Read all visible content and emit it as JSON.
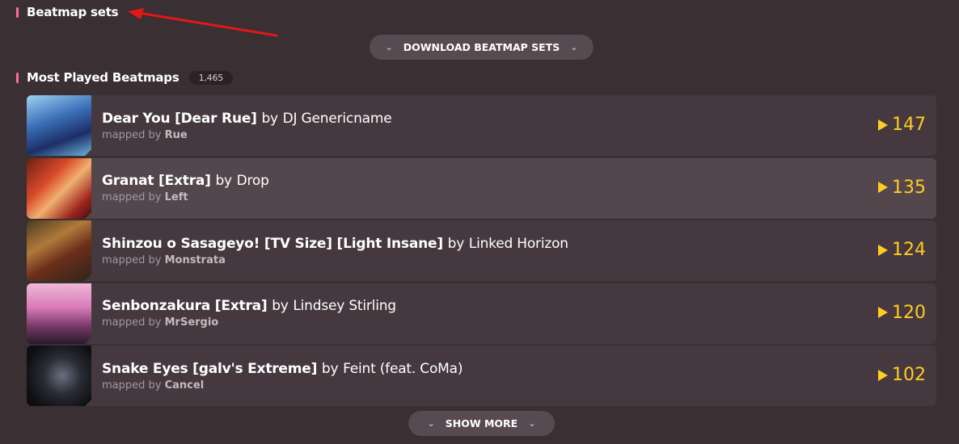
{
  "sections": {
    "beatmap_sets": {
      "title": "Beatmap sets"
    },
    "most_played": {
      "title": "Most Played Beatmaps",
      "count": "1,465"
    }
  },
  "buttons": {
    "download": "DOWNLOAD BEATMAP SETS",
    "show_more": "SHOW MORE"
  },
  "beatmaps": [
    {
      "title": "Dear You [Dear Rue]",
      "by": "by",
      "artist": "DJ Genericname",
      "mapped_by": "mapped by",
      "mapper": "Rue",
      "plays": "147"
    },
    {
      "title": "Granat [Extra]",
      "by": "by",
      "artist": "Drop",
      "mapped_by": "mapped by",
      "mapper": "Left",
      "plays": "135"
    },
    {
      "title": "Shinzou o Sasageyo! [TV Size] [Light Insane]",
      "by": "by",
      "artist": "Linked Horizon",
      "mapped_by": "mapped by",
      "mapper": "Monstrata",
      "plays": "124"
    },
    {
      "title": "Senbonzakura [Extra]",
      "by": "by",
      "artist": "Lindsey Stirling",
      "mapped_by": "mapped by",
      "mapper": "MrSergio",
      "plays": "120"
    },
    {
      "title": "Snake Eyes [galv's Extreme]",
      "by": "by",
      "artist": "Feint (feat. CoMa)",
      "mapped_by": "mapped by",
      "mapper": "Cancel",
      "plays": "102"
    }
  ],
  "colors": {
    "background": "#3a2f33",
    "row": "#45393f",
    "row_highlight": "#54464d",
    "accent_pink": "#ff66aa",
    "plays_yellow": "#ffcc22",
    "annotation_arrow": "#e01818"
  },
  "icons": {
    "section_marker": "pink-bar-icon",
    "chevron": "chevron-down-icon",
    "plays": "play-icon",
    "annotation": "red-arrow"
  }
}
